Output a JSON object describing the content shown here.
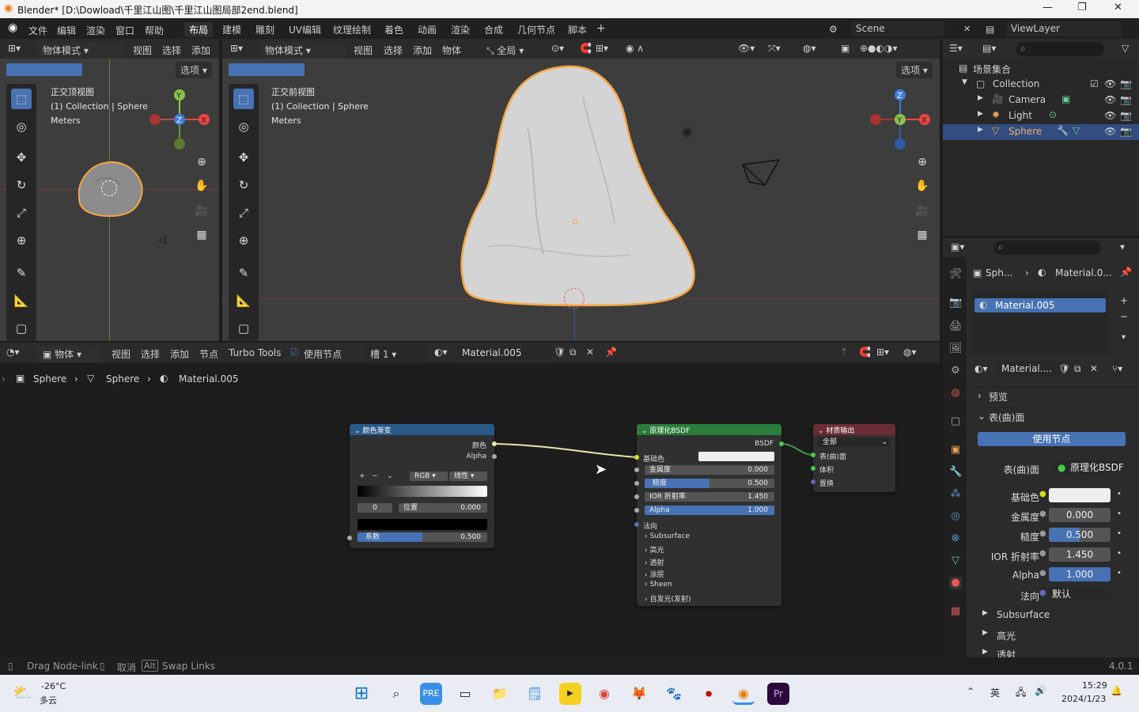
{
  "window": {
    "title": "Blender* [D:\\Dowload\\千里江山图\\千里江山图局部2end.blend]",
    "controls": [
      "—",
      "❐",
      "✕"
    ]
  },
  "menu": {
    "items": [
      "文件",
      "编辑",
      "渲染",
      "窗口",
      "帮助"
    ],
    "workspaces": [
      "布局",
      "建模",
      "雕刻",
      "UV编辑",
      "纹理绘制",
      "着色",
      "动画",
      "渲染",
      "合成",
      "几何节点",
      "脚本"
    ],
    "active_workspace": "布局",
    "scene": "Scene",
    "viewlayer": "ViewLayer"
  },
  "vp_left": {
    "mode": "物体模式",
    "menus": [
      "视图",
      "选择",
      "添加"
    ],
    "options": "选项",
    "view_name": "正交顶视图",
    "collection": "(1) Collection | Sphere",
    "units": "Meters"
  },
  "vp_right": {
    "mode": "物体模式",
    "menus": [
      "视图",
      "选择",
      "添加",
      "物体"
    ],
    "orientation": "全局",
    "options": "选项",
    "view_name": "正交前视图",
    "collection": "(1) Collection | Sphere",
    "units": "Meters"
  },
  "outliner": {
    "root": "场景集合",
    "collection": "Collection",
    "items": [
      "Camera",
      "Light",
      "Sphere"
    ]
  },
  "props": {
    "breadcrumb_obj": "Sph...",
    "breadcrumb_mat": "Material.0...",
    "slot": "Material.005",
    "mat_name": "Material....",
    "preview": "预览",
    "surface_panel": "表(曲)面",
    "use_nodes": "使用节点",
    "surface_label": "表(曲)面",
    "surface_value": "原理化BSDF",
    "rows": [
      {
        "label": "基础色",
        "value": ""
      },
      {
        "label": "金属度",
        "value": "0.000"
      },
      {
        "label": "糙度",
        "value": "0.500"
      },
      {
        "label": "IOR 折射率",
        "value": "1.450"
      },
      {
        "label": "Alpha",
        "value": "1.000"
      },
      {
        "label": "法向",
        "value": "默认"
      }
    ],
    "subpanels": [
      "Subsurface",
      "高光",
      "透射"
    ],
    "roughness_fraction": 0.5
  },
  "node_header": {
    "editor": "物体",
    "menus": [
      "视图",
      "选择",
      "添加",
      "节点"
    ],
    "turbo": "Turbo Tools",
    "use_nodes": "使用节点",
    "slot": "槽 1",
    "material": "Material.005"
  },
  "breadcrumb": {
    "a": "Sphere",
    "b": "Sphere",
    "c": "Material.005"
  },
  "node_ramp": {
    "title": "颜色渐变",
    "out_color": "颜色",
    "out_alpha": "Alpha",
    "mode": "RGB",
    "interp": "线性",
    "index": "0",
    "pos_label": "位置",
    "pos_value": "0.000",
    "fac_label": "系数",
    "fac_value": "0.500"
  },
  "node_bsdf": {
    "title": "原理化BSDF",
    "out": "BSDF",
    "base": "基础色",
    "metal": "金属度",
    "metal_v": "0.000",
    "rough": "糙度",
    "rough_v": "0.500",
    "ior": "IOR 折射率",
    "ior_v": "1.450",
    "alpha": "Alpha",
    "alpha_v": "1.000",
    "normal": "法向",
    "subs": [
      "Subsurface",
      "高光",
      "透射",
      "涂层",
      "Sheen",
      "自发光(发射)"
    ]
  },
  "node_output": {
    "title": "材质输出",
    "target": "全部",
    "in": [
      "表(曲)面",
      "体积",
      "置换"
    ]
  },
  "status": {
    "drag": "Drag Node-link",
    "cancel": "取消",
    "alt": "Alt",
    "swap": "Swap Links",
    "version": "4.0.1"
  },
  "taskbar": {
    "temp": "-26°C",
    "weather": "多云",
    "lang": "英",
    "time": "15:29",
    "date": "2024/1/23"
  },
  "colors": {
    "accent": "#4772b3",
    "select": "#f5a540",
    "node_green": "#2a7d3a",
    "node_blue": "#2a5a8a",
    "node_red": "#6b2c35"
  }
}
